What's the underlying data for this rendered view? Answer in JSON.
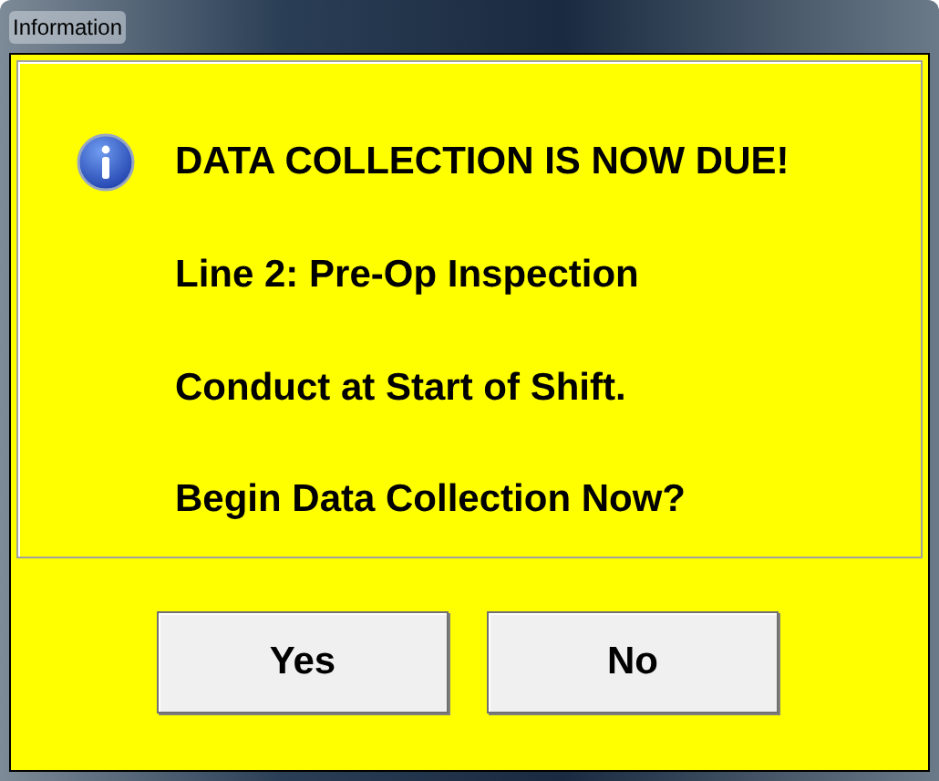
{
  "window": {
    "title": "Information"
  },
  "message": {
    "lines": [
      "DATA COLLECTION IS NOW DUE!",
      "Line 2: Pre-Op Inspection",
      "Conduct at Start of Shift.",
      "Begin Data Collection Now?"
    ]
  },
  "buttons": [
    "Yes",
    "No"
  ]
}
